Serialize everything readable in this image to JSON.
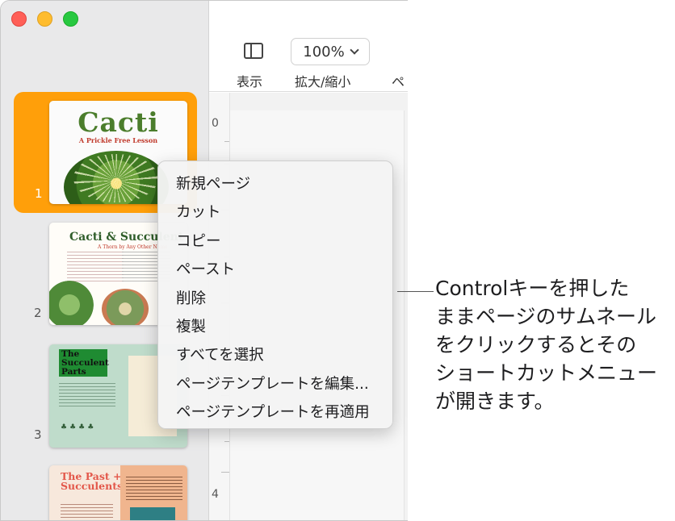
{
  "toolbar": {
    "view_label": "表示",
    "zoom_value": "100%",
    "zoom_label": "拡大/縮小",
    "page_label_partial": "ペ"
  },
  "ruler": {
    "marks": [
      "0",
      "4"
    ]
  },
  "thumbnails": [
    {
      "number": "1",
      "title": "Cacti",
      "subtitle": "A Prickle Free Lesson",
      "selected": true
    },
    {
      "number": "2",
      "title": "Cacti & Succulent",
      "subtitle": "A Thorn by Any Other Name",
      "selected": false
    },
    {
      "number": "3",
      "title": "The Succulent Parts",
      "selected": false
    },
    {
      "number": "",
      "title": "The Past + Future of Succulents",
      "selected": false
    }
  ],
  "context_menu": {
    "items": [
      "新規ページ",
      "カット",
      "コピー",
      "ペースト",
      "削除",
      "複製",
      "すべてを選択",
      "ページテンプレートを編集...",
      "ページテンプレートを再適用"
    ]
  },
  "callout": {
    "lines": [
      "Controlキーを押した",
      "ままページのサムネール",
      "をクリックするとその",
      "ショートカットメニュー",
      "が開きます。"
    ]
  },
  "colors": {
    "selection": "#ff9f0a",
    "close": "#ff5f57",
    "minimize": "#febc2e",
    "maximize": "#28c840"
  }
}
